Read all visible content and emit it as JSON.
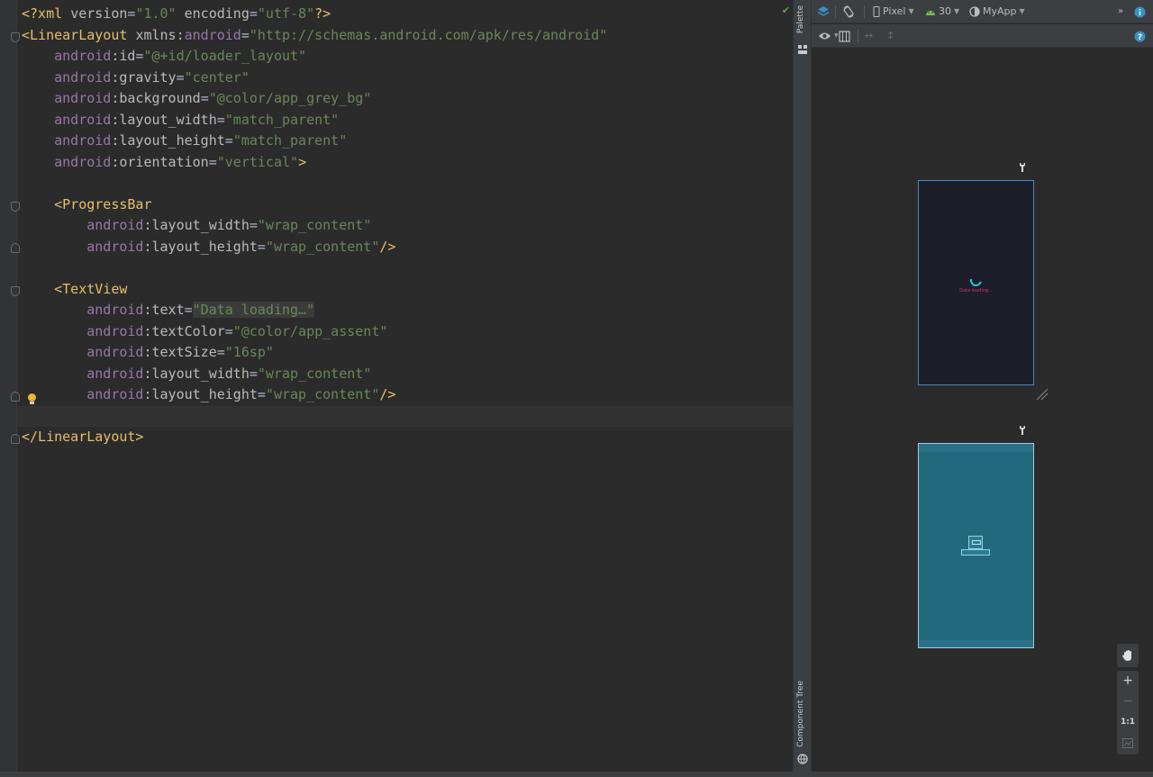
{
  "editor": {
    "lines": [
      {
        "parts": [
          [
            "tag",
            "<?xml "
          ],
          [
            "attr",
            "version"
          ],
          [
            "plain",
            "="
          ],
          [
            "str",
            "\"1.0\""
          ],
          [
            "plain",
            " "
          ],
          [
            "attr",
            "encoding"
          ],
          [
            "plain",
            "="
          ],
          [
            "str",
            "\"utf-8\""
          ],
          [
            "tag",
            "?>"
          ]
        ]
      },
      {
        "parts": [
          [
            "tag",
            "<LinearLayout "
          ],
          [
            "attr",
            "xmlns:"
          ],
          [
            "ns",
            "android"
          ],
          [
            "plain",
            "="
          ],
          [
            "str",
            "\"http://schemas.android.com/apk/res/android\""
          ]
        ]
      },
      {
        "parts": [
          [
            "plain",
            "    "
          ],
          [
            "ns",
            "android"
          ],
          [
            "attr",
            ":id"
          ],
          [
            "plain",
            "="
          ],
          [
            "str",
            "\"@+id/loader_layout\""
          ]
        ]
      },
      {
        "parts": [
          [
            "plain",
            "    "
          ],
          [
            "ns",
            "android"
          ],
          [
            "attr",
            ":gravity"
          ],
          [
            "plain",
            "="
          ],
          [
            "str",
            "\"center\""
          ]
        ]
      },
      {
        "parts": [
          [
            "plain",
            "    "
          ],
          [
            "ns",
            "android"
          ],
          [
            "attr",
            ":background"
          ],
          [
            "plain",
            "="
          ],
          [
            "str",
            "\"@color/app_grey_bg\""
          ]
        ]
      },
      {
        "parts": [
          [
            "plain",
            "    "
          ],
          [
            "ns",
            "android"
          ],
          [
            "attr",
            ":layout_width"
          ],
          [
            "plain",
            "="
          ],
          [
            "str",
            "\"match_parent\""
          ]
        ]
      },
      {
        "parts": [
          [
            "plain",
            "    "
          ],
          [
            "ns",
            "android"
          ],
          [
            "attr",
            ":layout_height"
          ],
          [
            "plain",
            "="
          ],
          [
            "str",
            "\"match_parent\""
          ]
        ]
      },
      {
        "parts": [
          [
            "plain",
            "    "
          ],
          [
            "ns",
            "android"
          ],
          [
            "attr",
            ":orientation"
          ],
          [
            "plain",
            "="
          ],
          [
            "str",
            "\"vertical\""
          ],
          [
            "tag",
            ">"
          ]
        ]
      },
      {
        "parts": []
      },
      {
        "parts": [
          [
            "plain",
            "    "
          ],
          [
            "tag",
            "<ProgressBar"
          ]
        ]
      },
      {
        "parts": [
          [
            "plain",
            "        "
          ],
          [
            "ns",
            "android"
          ],
          [
            "attr",
            ":layout_width"
          ],
          [
            "plain",
            "="
          ],
          [
            "str",
            "\"wrap_content\""
          ]
        ]
      },
      {
        "parts": [
          [
            "plain",
            "        "
          ],
          [
            "ns",
            "android"
          ],
          [
            "attr",
            ":layout_height"
          ],
          [
            "plain",
            "="
          ],
          [
            "str",
            "\"wrap_content\""
          ],
          [
            "tag",
            "/>"
          ]
        ]
      },
      {
        "parts": []
      },
      {
        "parts": [
          [
            "plain",
            "    "
          ],
          [
            "tag",
            "<TextView"
          ]
        ]
      },
      {
        "parts": [
          [
            "plain",
            "        "
          ],
          [
            "ns",
            "android"
          ],
          [
            "attr",
            ":text"
          ],
          [
            "plain",
            "="
          ],
          [
            "hlstr",
            "\"Data loading…\""
          ]
        ]
      },
      {
        "parts": [
          [
            "plain",
            "        "
          ],
          [
            "ns",
            "android"
          ],
          [
            "attr",
            ":textColor"
          ],
          [
            "plain",
            "="
          ],
          [
            "str",
            "\"@color/app_assent\""
          ]
        ]
      },
      {
        "parts": [
          [
            "plain",
            "        "
          ],
          [
            "ns",
            "android"
          ],
          [
            "attr",
            ":textSize"
          ],
          [
            "plain",
            "="
          ],
          [
            "str",
            "\"16sp\""
          ]
        ]
      },
      {
        "parts": [
          [
            "plain",
            "        "
          ],
          [
            "ns",
            "android"
          ],
          [
            "attr",
            ":layout_width"
          ],
          [
            "plain",
            "="
          ],
          [
            "str",
            "\"wrap_content\""
          ]
        ]
      },
      {
        "parts": [
          [
            "plain",
            "        "
          ],
          [
            "ns",
            "android"
          ],
          [
            "attr",
            ":layout_height"
          ],
          [
            "plain",
            "="
          ],
          [
            "str",
            "\"wrap_content\""
          ],
          [
            "tag",
            "/>"
          ]
        ]
      },
      {
        "parts": []
      },
      {
        "parts": [
          [
            "tag",
            "</LinearLayout>"
          ]
        ]
      }
    ],
    "inspection_status_icon": "checkmark-icon"
  },
  "side_strip": {
    "palette_label": "Palette",
    "component_tree_label": "Component Tree"
  },
  "toolbar_top": {
    "device_label": "Pixel",
    "api_label": "30",
    "theme_label": "MyApp"
  },
  "toolbar_second": {
    "help_icon": "help-icon"
  },
  "preview": {
    "loading_text": "Data loading..."
  },
  "zoom": {
    "pan_icon": "hand-icon",
    "zoom_in": "+",
    "zoom_out": "−",
    "reset": "1:1"
  },
  "colors": {
    "accent": "#d0356b",
    "spinner": "#26c6da",
    "design_bg": "#1c1e2a",
    "blueprint_bg": "#23697e",
    "selection_border": "#4a88c7"
  }
}
